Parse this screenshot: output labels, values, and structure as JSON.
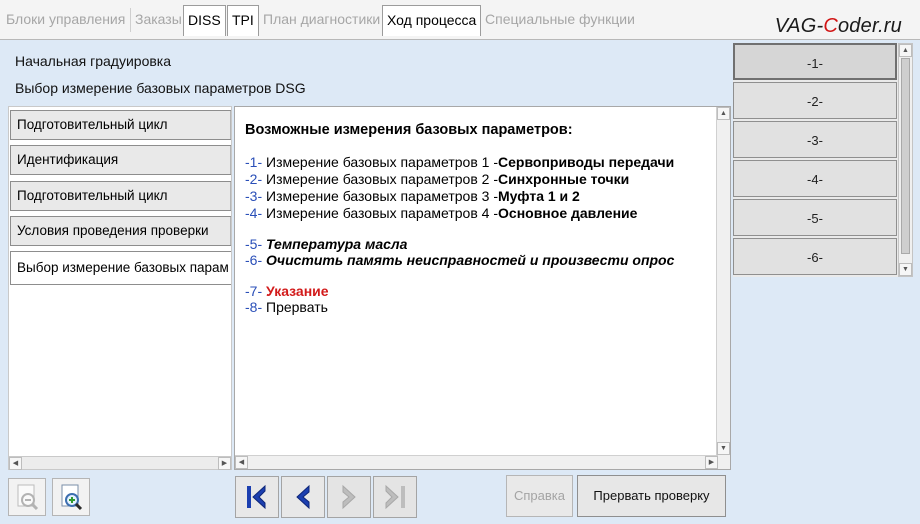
{
  "tabs": [
    {
      "label": "Блоки управления",
      "state": "disabled"
    },
    {
      "label": "Заказы",
      "state": "disabled"
    },
    {
      "label": "DISS",
      "state": "active"
    },
    {
      "label": "TPI",
      "state": "active"
    },
    {
      "label": "План диагностики",
      "state": "disabled"
    },
    {
      "label": "Ход процесса",
      "state": "active"
    },
    {
      "label": "Специальные функции",
      "state": "disabled"
    }
  ],
  "brand": {
    "prefix": "VAG-",
    "highlight": "C",
    "suffix": "oder.ru"
  },
  "header": {
    "line1": "Начальная градуировка",
    "line2": "Выбор измерение базовых параметров DSG"
  },
  "steps": [
    {
      "label": "Подготовительный цикл"
    },
    {
      "label": "Идентификация"
    },
    {
      "label": "Подготовительный цикл"
    },
    {
      "label": "Условия проведения проверки"
    },
    {
      "label": "Выбор измерение базовых парам"
    }
  ],
  "content": {
    "title": "Возможные измерения базовых параметров:",
    "items": [
      {
        "num": "-1-",
        "text": " Измерение базовых параметров 1 -",
        "bold": "Сервоприводы передачи"
      },
      {
        "num": "-2-",
        "text": " Измерение базовых параметров 2 -",
        "bold": "Синхронные точки"
      },
      {
        "num": "-3-",
        "text": " Измерение базовых параметров 3 -",
        "bold": "Муфта 1 и 2"
      },
      {
        "num": "-4-",
        "text": " Измерение базовых параметров 4 -",
        "bold": "Основное давление"
      },
      {
        "num": "-5-",
        "text": "",
        "bold": " Температура масла"
      },
      {
        "num": "-6-",
        "text": "",
        "bold": " Очистить память неисправностей и произвести опрос"
      },
      {
        "num": "-7-",
        "text": "",
        "bold": " Указание"
      },
      {
        "num": "-8-",
        "text": " Прервать",
        "bold": ""
      }
    ]
  },
  "right_buttons": [
    "-1-",
    "-2-",
    "-3-",
    "-4-",
    "-5-",
    "-6-"
  ],
  "toolbar": {
    "help_label": "Справка",
    "abort_label": "Прервать проверку"
  },
  "icons": {
    "first": "skip-first-icon",
    "prev": "arrow-left-icon",
    "next": "arrow-right-icon",
    "last": "skip-last-icon"
  },
  "colors": {
    "accent_blue": "#1c3fb0",
    "red": "#d21a1a"
  }
}
